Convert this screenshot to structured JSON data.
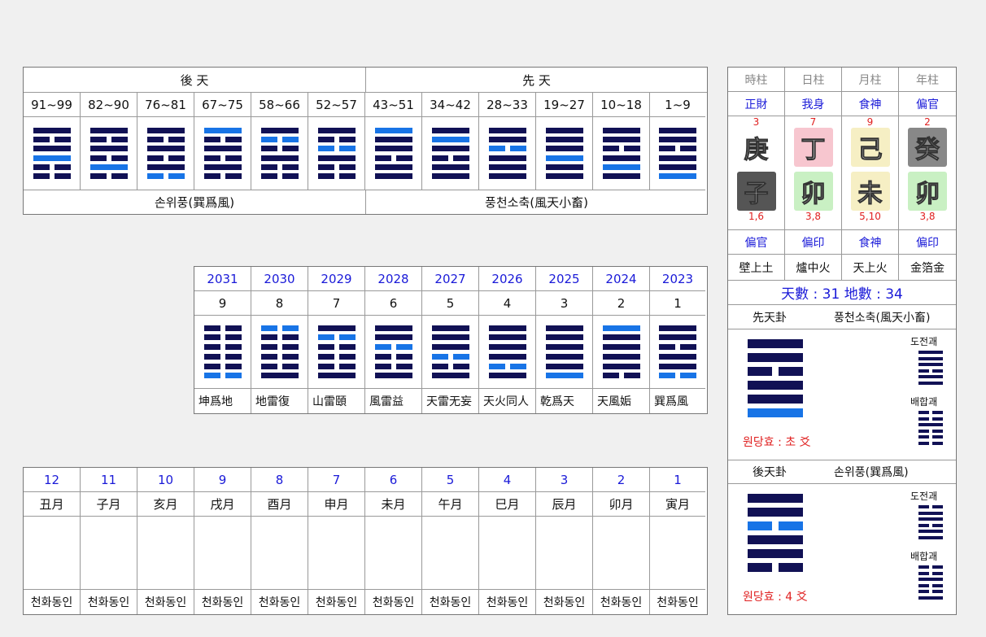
{
  "colors": {
    "yang": "#111155",
    "moving": "#1874e6",
    "accent_text": "#1a1ad8",
    "red": "#e02020"
  },
  "top": {
    "hucheon_label": "後 天",
    "seoncheon_label": "先 天",
    "ages": [
      "91~99",
      "82~90",
      "76~81",
      "67~75",
      "58~66",
      "52~57",
      "43~51",
      "34~42",
      "28~33",
      "19~27",
      "10~18",
      "1~9"
    ],
    "hexes": [
      [
        "y",
        "y",
        "y",
        "b",
        "y",
        "y"
      ],
      [
        "y",
        "y",
        "y",
        "y",
        "b",
        "y"
      ],
      [
        "y",
        "y",
        "y",
        "y",
        "y",
        "b"
      ],
      [
        "b",
        "y",
        "y",
        "y",
        "y",
        "y"
      ],
      [
        "y",
        "b",
        "y",
        "y",
        "y",
        "y"
      ],
      [
        "y",
        "y",
        "b",
        "y",
        "y",
        "y"
      ],
      [
        "B",
        "y",
        "y",
        "y",
        "y",
        "y"
      ],
      [
        "y",
        "B",
        "y",
        "y",
        "y",
        "y"
      ],
      [
        "y",
        "y",
        "b",
        "y",
        "y",
        "y"
      ],
      [
        "y",
        "y",
        "y",
        "B",
        "y",
        "y"
      ],
      [
        "y",
        "y",
        "y",
        "y",
        "B",
        "y"
      ],
      [
        "y",
        "y",
        "y",
        "y",
        "y",
        "B"
      ]
    ],
    "hexes_yin": [
      [
        false,
        true,
        false,
        false,
        true,
        true
      ],
      [
        false,
        true,
        false,
        true,
        false,
        true
      ],
      [
        false,
        true,
        false,
        true,
        false,
        true
      ],
      [
        false,
        true,
        false,
        true,
        false,
        true
      ],
      [
        false,
        true,
        true,
        false,
        true,
        true
      ],
      [
        false,
        true,
        true,
        false,
        true,
        true
      ],
      [
        false,
        false,
        false,
        true,
        false,
        false
      ],
      [
        false,
        false,
        false,
        true,
        false,
        false
      ],
      [
        false,
        false,
        true,
        false,
        false,
        false
      ],
      [
        false,
        false,
        false,
        false,
        false,
        false
      ],
      [
        false,
        false,
        true,
        false,
        false,
        false
      ],
      [
        false,
        false,
        true,
        false,
        false,
        false
      ]
    ],
    "hucheon_name": "손위풍(巽爲風)",
    "seoncheon_name": "풍천소축(風天小畜)"
  },
  "years": {
    "years": [
      "2031",
      "2030",
      "2029",
      "2028",
      "2027",
      "2026",
      "2025",
      "2024",
      "2023"
    ],
    "nums": [
      "9",
      "8",
      "7",
      "6",
      "5",
      "4",
      "3",
      "2",
      "1"
    ],
    "names": [
      "坤爲地",
      "地雷復",
      "山雷頤",
      "風雷益",
      "天雷无妄",
      "天火同人",
      "乾爲天",
      "天風姤",
      "巽爲風"
    ],
    "hex_yin": [
      [
        true,
        true,
        true,
        true,
        true,
        true
      ],
      [
        true,
        true,
        true,
        true,
        true,
        false
      ],
      [
        false,
        true,
        true,
        true,
        true,
        false
      ],
      [
        false,
        false,
        true,
        true,
        true,
        false
      ],
      [
        false,
        false,
        false,
        true,
        true,
        false
      ],
      [
        false,
        false,
        false,
        false,
        true,
        false
      ],
      [
        false,
        false,
        false,
        false,
        false,
        false
      ],
      [
        false,
        false,
        false,
        false,
        false,
        true
      ],
      [
        false,
        false,
        true,
        false,
        false,
        true
      ]
    ],
    "hex_moving": [
      5,
      0,
      1,
      2,
      3,
      4,
      5,
      0,
      5
    ]
  },
  "months": {
    "nums": [
      "12",
      "11",
      "10",
      "9",
      "8",
      "7",
      "6",
      "5",
      "4",
      "3",
      "2",
      "1"
    ],
    "names": [
      "丑月",
      "子月",
      "亥月",
      "戌月",
      "酉月",
      "申月",
      "未月",
      "午月",
      "巳月",
      "辰月",
      "卯月",
      "寅月"
    ],
    "bottom": [
      "천화동인",
      "천화동인",
      "천화동인",
      "천화동인",
      "천화동인",
      "천화동인",
      "천화동인",
      "천화동인",
      "천화동인",
      "천화동인",
      "천화동인",
      "천화동인"
    ]
  },
  "saju": {
    "headers": [
      "時柱",
      "日柱",
      "月柱",
      "年柱"
    ],
    "stem_gods": [
      "正財",
      "我身",
      "食神",
      "偏官"
    ],
    "stem_nums": [
      "3",
      "7",
      "9",
      "2"
    ],
    "stems": [
      "庚",
      "丁",
      "己",
      "癸"
    ],
    "stem_colors": [
      "#ffffff",
      "#f7c6cf",
      "#f6efc4",
      "#888888"
    ],
    "branches": [
      "子",
      "卯",
      "未",
      "卯"
    ],
    "branch_colors": [
      "#555555",
      "#c9f0c3",
      "#f6efc4",
      "#c9f0c3"
    ],
    "branch_nums": [
      "1,6",
      "3,8",
      "5,10",
      "3,8"
    ],
    "branch_gods": [
      "偏官",
      "偏印",
      "食神",
      "偏印"
    ],
    "napeum": [
      "壁上土",
      "爐中火",
      "天上火",
      "金箔金"
    ],
    "heaven_earth": "天數 : 31  地數 : 34",
    "seoncheon_label": "先天卦",
    "seoncheon_name": "풍천소축(風天小畜)",
    "hucheon_label": "後天卦",
    "hucheon_name": "손위풍(巽爲風)",
    "dojeon": "도전괘",
    "baehap": "배합괘",
    "wondang1": "원당효 : 초 爻",
    "wondang2": "원당효 : 4 爻"
  }
}
